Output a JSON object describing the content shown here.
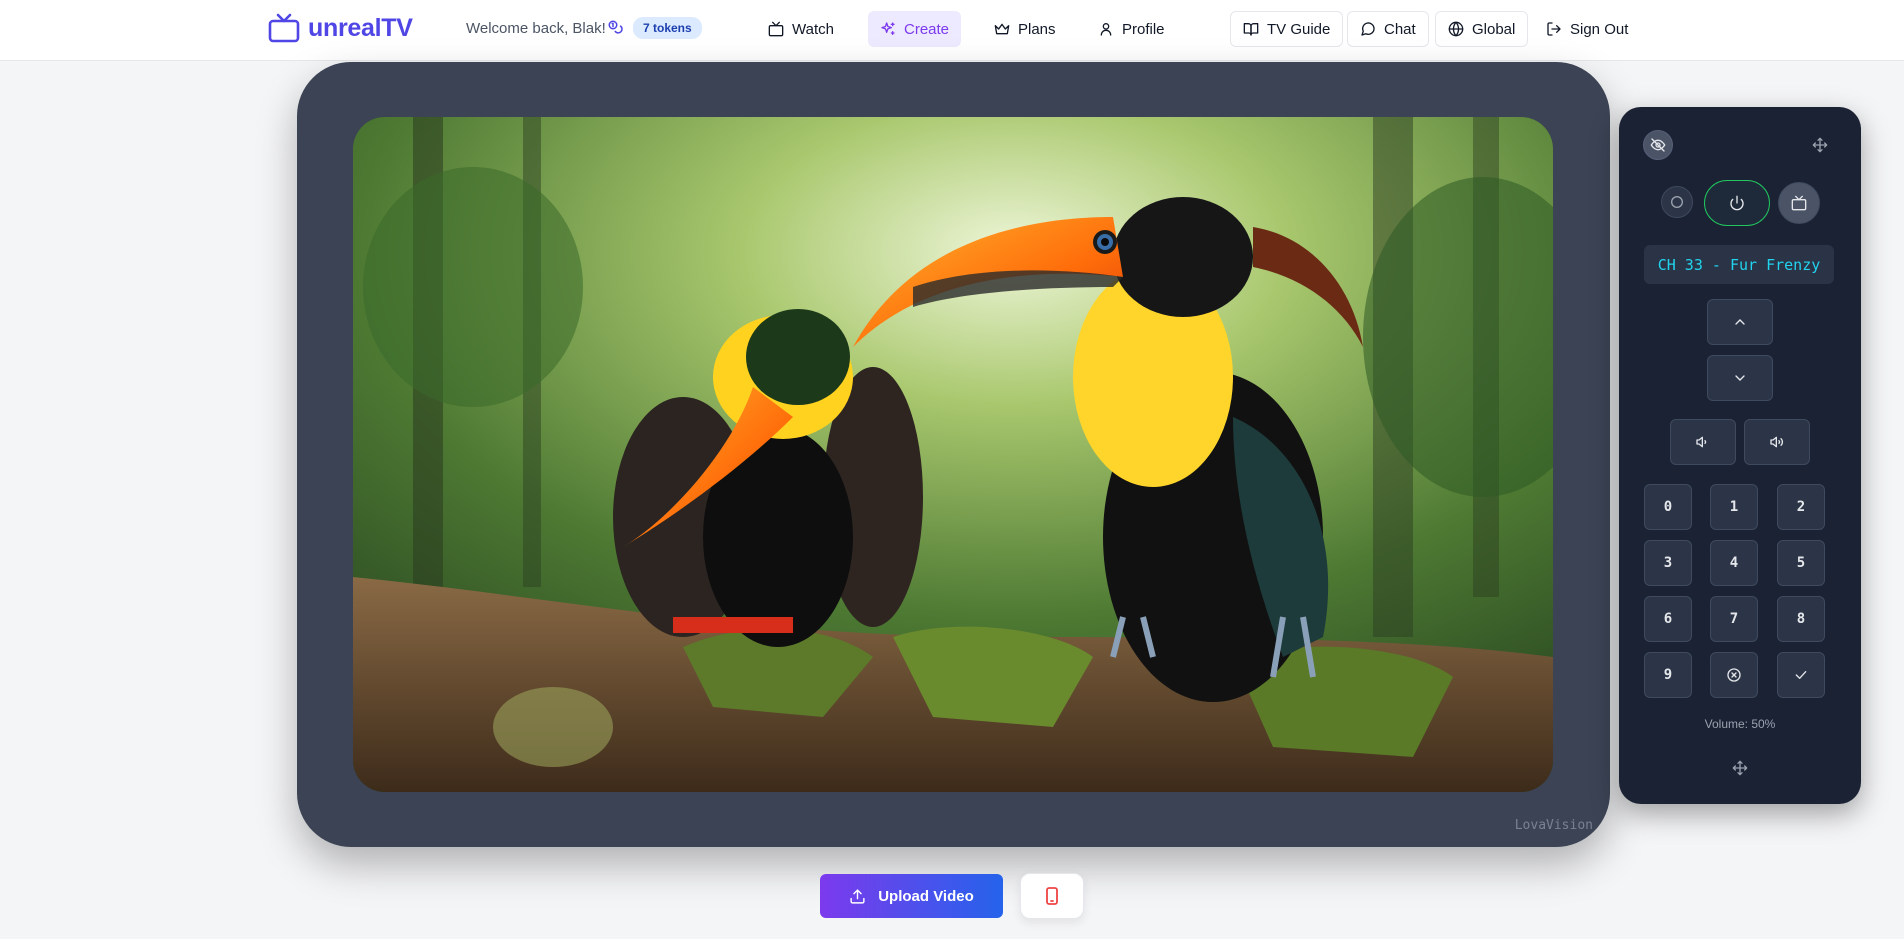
{
  "header": {
    "logo_text": "unrealTV",
    "welcome": "Welcome back, Blak!",
    "tokens": "7 tokens",
    "nav": {
      "watch": "Watch",
      "create": "Create",
      "plans": "Plans",
      "profile": "Profile",
      "tv_guide": "TV Guide",
      "chat": "Chat",
      "global": "Global",
      "sign_out": "Sign Out"
    }
  },
  "tv": {
    "brand": "LovaVision"
  },
  "remote": {
    "channel_display": "CH 33 - Fur Frenzy",
    "keys": [
      "0",
      "1",
      "2",
      "3",
      "4",
      "5",
      "6",
      "7",
      "8",
      "9"
    ],
    "volume_label": "Volume: 50%",
    "volume_level": 50
  },
  "actions": {
    "upload_label": "Upload Video"
  },
  "colors": {
    "brand": "#4f46e5",
    "accent": "#7c3aed",
    "lcd": "#22d3ee",
    "power": "#22c55e",
    "danger": "#ef4444"
  }
}
